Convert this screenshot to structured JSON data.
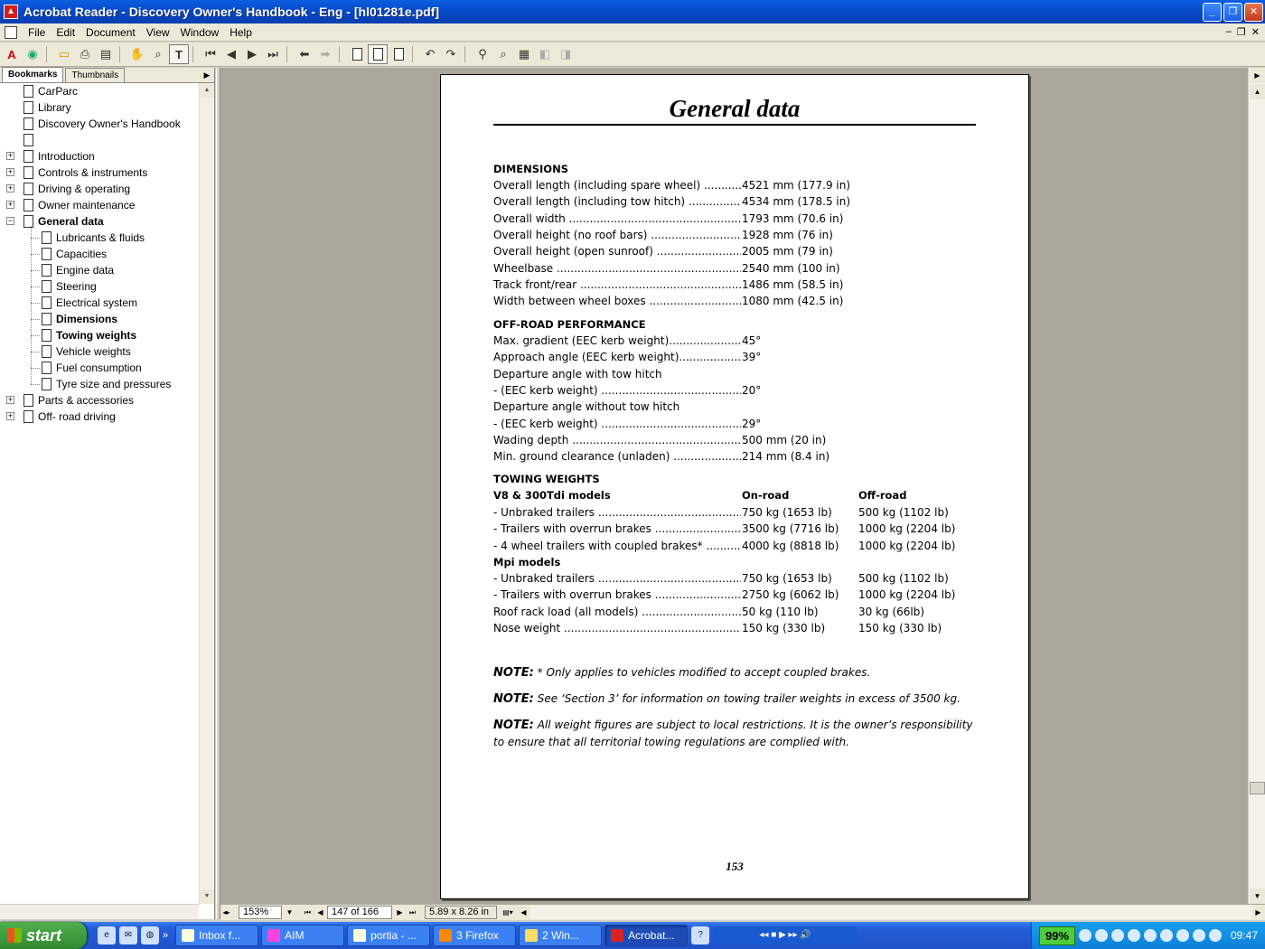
{
  "window": {
    "title": "Acrobat Reader - Discovery Owner's Handbook - Eng - [hl01281e.pdf]",
    "app_icon": "acrobat-icon"
  },
  "menu": [
    "File",
    "Edit",
    "Document",
    "View",
    "Window",
    "Help"
  ],
  "toolbar_icons": [
    "acrobat-logo-icon",
    "web-icon",
    "open-icon",
    "print-icon",
    "show-hide-nav-icon",
    "hand-tool-icon",
    "zoom-tool-icon",
    "text-select-icon",
    "first-page-icon",
    "previous-page-icon",
    "next-page-icon",
    "last-page-icon",
    "go-back-icon",
    "go-forward-icon",
    "actual-size-icon",
    "fit-page-icon",
    "fit-width-icon",
    "rotate-ccw-icon",
    "rotate-cw-icon",
    "find-icon",
    "search-icon",
    "search-results-icon",
    "previous-highlight-icon",
    "next-highlight-icon"
  ],
  "nav": {
    "tabs": [
      "Bookmarks",
      "Thumbnails"
    ],
    "bookmarks": [
      {
        "label": "CarParc",
        "level": 0,
        "expander": "",
        "bold": false
      },
      {
        "label": "Library",
        "level": 0,
        "expander": "",
        "bold": false
      },
      {
        "label": "Discovery Owner's Handbook",
        "level": 0,
        "expander": "",
        "bold": false
      },
      {
        "label": "",
        "level": 0,
        "expander": "",
        "bold": false
      },
      {
        "label": "Introduction",
        "level": 0,
        "expander": "+",
        "bold": false
      },
      {
        "label": "Controls & instruments",
        "level": 0,
        "expander": "+",
        "bold": false
      },
      {
        "label": "Driving & operating",
        "level": 0,
        "expander": "+",
        "bold": false
      },
      {
        "label": "Owner maintenance",
        "level": 0,
        "expander": "+",
        "bold": false
      },
      {
        "label": "General data",
        "level": 0,
        "expander": "-",
        "bold": true
      },
      {
        "label": "Lubricants & fluids",
        "level": 1,
        "expander": "",
        "bold": false
      },
      {
        "label": "Capacities",
        "level": 1,
        "expander": "",
        "bold": false
      },
      {
        "label": "Engine data",
        "level": 1,
        "expander": "",
        "bold": false
      },
      {
        "label": "Steering",
        "level": 1,
        "expander": "",
        "bold": false
      },
      {
        "label": "Electrical system",
        "level": 1,
        "expander": "",
        "bold": false
      },
      {
        "label": "Dimensions",
        "level": 1,
        "expander": "",
        "bold": true
      },
      {
        "label": "Towing weights",
        "level": 1,
        "expander": "",
        "bold": true
      },
      {
        "label": "Vehicle weights",
        "level": 1,
        "expander": "",
        "bold": false
      },
      {
        "label": "Fuel consumption",
        "level": 1,
        "expander": "",
        "bold": false
      },
      {
        "label": "Tyre size and pressures",
        "level": 1,
        "expander": "",
        "bold": false
      },
      {
        "label": "Parts & accessories",
        "level": 0,
        "expander": "+",
        "bold": false
      },
      {
        "label": "Off- road driving",
        "level": 0,
        "expander": "+",
        "bold": false
      }
    ]
  },
  "document": {
    "title": "General data",
    "dimensions": {
      "heading": "DIMENSIONS",
      "rows": [
        {
          "label": "Overall length (including spare wheel) ",
          "value": "4521 mm (177.9 in)"
        },
        {
          "label": "Overall length (including tow hitch) ",
          "value": "4534 mm (178.5 in)"
        },
        {
          "label": "Overall width ",
          "value": "1793 mm (70.6 in)"
        },
        {
          "label": "Overall height (no roof bars) ",
          "value": "1928 mm (76 in)"
        },
        {
          "label": "Overall height (open sunroof) ",
          "value": "2005 mm (79 in)"
        },
        {
          "label": "Wheelbase ",
          "value": "2540 mm (100 in)"
        },
        {
          "label": "Track front/rear ",
          "value": "1486 mm (58.5 in)"
        },
        {
          "label": "Width between wheel boxes ",
          "value": "1080 mm (42.5 in)"
        }
      ]
    },
    "offroad": {
      "heading": "OFF-ROAD PERFORMANCE",
      "rows": [
        {
          "label": "Max. gradient (EEC kerb weight)",
          "value": "45°",
          "dots": true
        },
        {
          "label": "Approach angle (EEC kerb weight)",
          "value": "39°",
          "dots": true
        },
        {
          "label": "Departure angle with tow hitch",
          "value": "",
          "dots": false
        },
        {
          "label": "- (EEC kerb weight) ",
          "value": "20°",
          "dots": true
        },
        {
          "label": "Departure angle without tow hitch",
          "value": "",
          "dots": false
        },
        {
          "label": "- (EEC kerb weight) ",
          "value": "29°",
          "dots": true
        },
        {
          "label": "Wading depth ",
          "value": "500 mm (20 in)",
          "dots": true
        },
        {
          "label": "Min. ground clearance (unladen) ",
          "value": "214 mm (8.4 in)",
          "dots": true
        }
      ]
    },
    "towing": {
      "heading": "TOWING WEIGHTS",
      "group1": "V8 & 300Tdi models",
      "col_onroad": "On-road",
      "col_offroad": "Off-road",
      "rows1": [
        {
          "label": "- Unbraked trailers ",
          "on": "750 kg (1653 lb)",
          "off": "500 kg (1102 lb)"
        },
        {
          "label": "- Trailers with overrun brakes ",
          "on": "3500 kg (7716 lb)",
          "off": "1000 kg (2204 lb)"
        },
        {
          "label": "- 4 wheel trailers with coupled brakes* ",
          "on": "4000 kg (8818 lb)",
          "off": "1000 kg (2204 lb)"
        }
      ],
      "group2": "Mpi models",
      "rows2": [
        {
          "label": "- Unbraked trailers ",
          "on": "750 kg (1653 lb)",
          "off": "500 kg (1102 lb)"
        },
        {
          "label": "- Trailers with overrun brakes ",
          "on": "2750 kg (6062 lb)",
          "off": "1000 kg (2204 lb)"
        },
        {
          "label": "Roof rack load (all models) ",
          "on": "50 kg (110 lb)",
          "off": "30 kg (66lb)"
        },
        {
          "label": "Nose weight ",
          "on": "150 kg (330 lb)",
          "off": "150 kg (330 lb)"
        }
      ]
    },
    "notes": [
      {
        "prefix": "NOTE:",
        "text": " * Only applies to vehicles modified to accept coupled brakes."
      },
      {
        "prefix": "NOTE:",
        "text": " See ‘Section 3’ for information on towing trailer weights in excess of 3500 kg."
      },
      {
        "prefix": "NOTE:",
        "text": " All weight figures are subject to local restrictions. It is the owner’s responsibility to ensure that all territorial towing regulations are complied with."
      }
    ],
    "page_number": "153"
  },
  "status": {
    "zoom": "153%",
    "page": "147 of 166",
    "page_size": "5.89 x 8.26 in"
  },
  "taskbar": {
    "start": "start",
    "tasks": [
      "Inbox f...",
      "AIM",
      "portia - ...",
      "3 Firefox",
      "2 Win...",
      "Acrobat..."
    ],
    "battery": "99%",
    "clock": "09:47"
  }
}
